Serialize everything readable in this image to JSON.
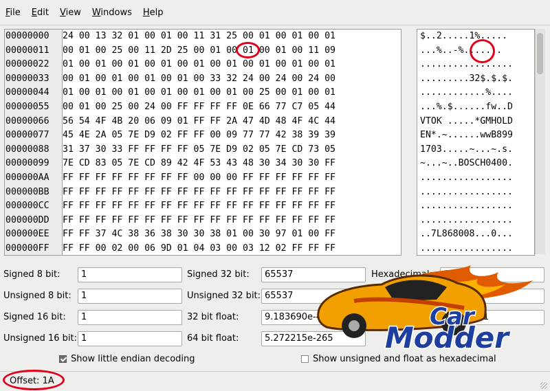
{
  "menu": [
    {
      "label": "File",
      "mnemonic": "F",
      "rest": "ile"
    },
    {
      "label": "Edit",
      "mnemonic": "E",
      "rest": "dit"
    },
    {
      "label": "View",
      "mnemonic": "V",
      "rest": "iew"
    },
    {
      "label": "Windows",
      "mnemonic": "W",
      "rest": "indows"
    },
    {
      "label": "Help",
      "mnemonic": "H",
      "rest": "elp"
    }
  ],
  "hex": {
    "offsets": [
      "00000000",
      "00000011",
      "00000022",
      "00000033",
      "00000044",
      "00000055",
      "00000066",
      "00000077",
      "00000088",
      "00000099",
      "000000AA",
      "000000BB",
      "000000CC",
      "000000DD",
      "000000EE",
      "000000FF"
    ],
    "rows": [
      "24 00 13 32 01 00 01 00 11 31 25 00 01 00 01 00 01",
      "00 01 00 25 00 11 2D 25 00 01 00 01 00 01 00 11 09",
      "01 00 01 00 01 00 01 00 01 00 01 00 01 00 01 00 01",
      "00 01 00 01 00 01 00 01 00 33 32 24 00 24 00 24 00",
      "01 00 01 00 01 00 01 00 01 00 01 00 25 00 01 00 01",
      "00 01 00 25 00 24 00 FF FF FF FF 0E 66 77 C7 05 44",
      "56 54 4F 4B 20 06 09 01 FF FF 2A 47 4D 48 4F 4C 44",
      "45 4E 2A 05 7E D9 02 FF FF 00 09 77 77 42 38 39 39",
      "31 37 30 33 FF FF FF FF 05 7E D9 02 05 7E CD 73 05",
      "7E CD 83 05 7E CD 89 42 4F 53 43 48 30 34 30 30 FF",
      "FF FF FF FF FF FF FF FF 00 00 00 FF FF FF FF FF FF",
      "FF FF FF FF FF FF FF FF FF FF FF FF FF FF FF FF FF",
      "FF FF FF FF FF FF FF FF FF FF FF FF FF FF FF FF FF",
      "FF FF FF FF FF FF FF FF FF FF FF FF FF FF FF FF FF",
      "FF FF 37 4C 38 36 38 30 30 38 01 00 30 97 01 00 FF",
      "FF FF 00 02 00 06 9D 01 04 03 00 03 12 02 FF FF FF"
    ],
    "ascii": [
      "$..2.....1%.....",
      "...%..-%.......",
      ".................",
      ".........32$.$.$.",
      "............%....",
      "...%.$......fw..D",
      "VTOK .....*GMHOLD",
      "EN*.~......wwB899",
      "1703.....~...~.s.",
      "~...~..BOSCH0400.",
      ".................",
      ".................",
      ".................",
      ".................",
      "..7L868008...0...",
      "................."
    ]
  },
  "decode": {
    "signed8": {
      "label": "Signed 8 bit:",
      "value": "1"
    },
    "unsigned8": {
      "label": "Unsigned 8 bit:",
      "value": "1"
    },
    "signed16": {
      "label": "Signed 16 bit:",
      "value": "1"
    },
    "unsigned16": {
      "label": "Unsigned 16 bit:",
      "value": "1"
    },
    "signed32": {
      "label": "Signed 32 bit:",
      "value": "65537"
    },
    "unsigned32": {
      "label": "Unsigned 32 bit:",
      "value": "65537"
    },
    "float32": {
      "label": "32 bit float:",
      "value": "9.183690e-41"
    },
    "float64": {
      "label": "64 bit float:",
      "value": "5.272215e-265"
    },
    "hexadecimal": {
      "label": "Hexadecimal:",
      "value": "01"
    },
    "octal": {
      "value": "001"
    },
    "binary": {
      "value": "00000001"
    }
  },
  "options": {
    "little_endian": {
      "label": "Show little endian decoding",
      "checked": true
    },
    "unsigned_hex": {
      "label": "Show unsigned and float as hexadecimal",
      "checked": false
    }
  },
  "status": {
    "offset": "Offset: 1A"
  },
  "logo": {
    "line1": "Car",
    "line2": "Modder"
  },
  "colors": {
    "annotation": "#e3001b",
    "logo_text": "#1f3fa0",
    "car_body": "#f2a000"
  }
}
